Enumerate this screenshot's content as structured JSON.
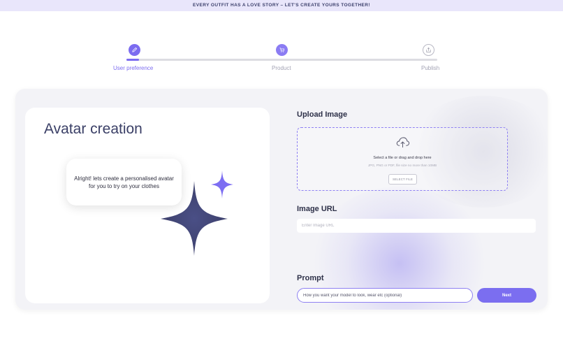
{
  "banner": {
    "text": "EVERY OUTFIT HAS A LOVE STORY – LET'S CREATE YOURS TOGETHER!"
  },
  "stepper": {
    "steps": [
      {
        "label": "User  preference",
        "icon": "pencil-icon",
        "state": "active"
      },
      {
        "label": "Product",
        "icon": "cart-icon",
        "state": "upcoming"
      },
      {
        "label": "Publish",
        "icon": "publish-icon",
        "state": "upcoming"
      }
    ],
    "accent": "#7c6cf0"
  },
  "avatar": {
    "title": "Avatar creation",
    "message": "Alright! lets create a personalised avatar for you to try on your clothes"
  },
  "upload": {
    "title": "Upload Image",
    "instruction": "Select a file or drag and drop here",
    "hint": "JPG, PNG or PDF, file size no more than 10MB",
    "button": "SELECT FILE"
  },
  "image_url": {
    "title": "Image URL",
    "placeholder": "Enter Image URL"
  },
  "prompt": {
    "title": "Prompt",
    "placeholder": "How you want your model to look, wear etc (optional)",
    "next_label": "Next"
  },
  "colors": {
    "primary": "#7b6ef0",
    "heading": "#3a3f66",
    "banner_bg": "#e9e6fb"
  }
}
